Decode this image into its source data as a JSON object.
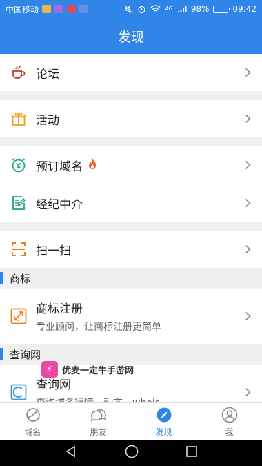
{
  "status_bar": {
    "carrier": "中国移动",
    "network": "4G",
    "battery": "98%",
    "battery_level": 0.98,
    "time": "09:42"
  },
  "header": {
    "title": "发现"
  },
  "menu": {
    "forum": "论坛",
    "activity": "活动",
    "reserve_domain": "预订域名",
    "broker": "经纪中介",
    "scan": "扫一扫"
  },
  "trademark_section": {
    "heading": "商标",
    "item_title": "商标注册",
    "item_subtitle": "专业顾问，让商标注册更简单"
  },
  "query_section": {
    "heading": "查询网",
    "item_title": "查询网",
    "item_subtitle": "查询域名行情、动态、whois"
  },
  "watermark": {
    "text": "优麦一定牛手游网"
  },
  "tabs": [
    {
      "label": "域名"
    },
    {
      "label": "朋友"
    },
    {
      "label": "发现"
    },
    {
      "label": "我"
    }
  ],
  "colors": {
    "brand_blue": "#2f86e8",
    "flame": "#f05a28",
    "forum_red": "#c0392b",
    "activity_orange": "#f0a020",
    "green": "#1fa37a",
    "trademark_orange": "#f07a1a",
    "query_blue": "#3a9ad9"
  }
}
